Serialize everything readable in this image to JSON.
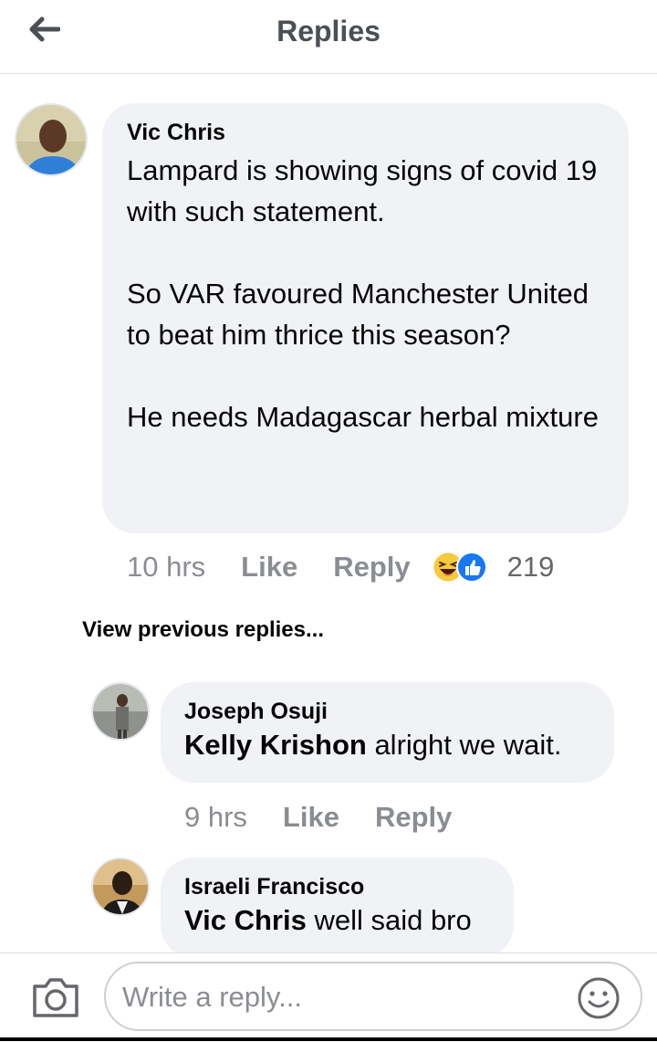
{
  "header": {
    "title": "Replies",
    "back_icon": "back-arrow-icon"
  },
  "main_comment": {
    "author": "Vic Chris",
    "text": "Lampard is showing signs of covid 19 with such statement.\n\nSo VAR favoured Manchester United to beat him thrice this season?\n\nHe needs Madagascar herbal mixture",
    "time": "10 hrs",
    "like_label": "Like",
    "reply_label": "Reply",
    "reaction_count": "219",
    "reaction_icons": [
      "haha-reaction-icon",
      "like-reaction-icon"
    ]
  },
  "view_previous_label": "View previous replies...",
  "replies": [
    {
      "author": "Joseph Osuji",
      "mention": "Kelly Krishon",
      "text": " alright we wait.",
      "time": "9 hrs",
      "like_label": "Like",
      "reply_label": "Reply"
    },
    {
      "author": "Israeli Francisco",
      "mention": "Vic Chris",
      "text": " well said bro"
    }
  ],
  "footer": {
    "placeholder": "Write a reply...",
    "camera_icon": "camera-icon",
    "emoji_icon": "emoji-icon"
  },
  "colors": {
    "bubble": "#f0f2f5",
    "like_blue": "#1877f2",
    "muted": "#8a8d91"
  }
}
